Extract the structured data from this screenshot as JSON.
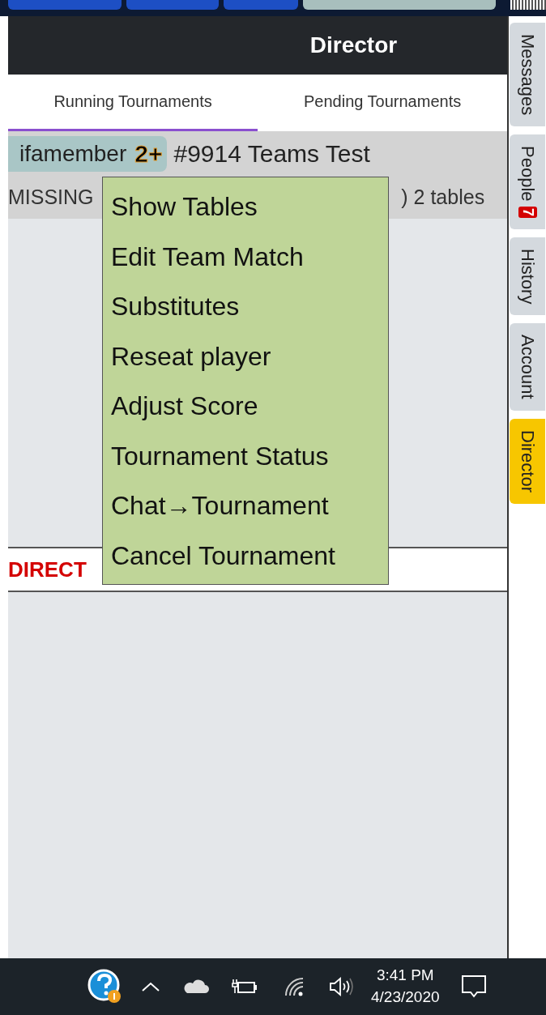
{
  "browser_tabs": [
    {
      "selected": false
    },
    {
      "selected": false
    },
    {
      "selected": false
    },
    {
      "selected": true
    }
  ],
  "header": {
    "title": "Director"
  },
  "tabs": [
    {
      "label": "Running Tournaments",
      "selected": true
    },
    {
      "label": "Pending Tournaments",
      "selected": false
    }
  ],
  "tournament": {
    "user": "ifamember",
    "badge": "2+",
    "title": "#9914 Teams Test",
    "status_left": "MISSING",
    "status_right": ") 2 tables"
  },
  "director_calls": {
    "label": "DIRECT"
  },
  "context_menu": {
    "items": [
      "Show Tables",
      "Edit Team Match",
      "Substitutes",
      "Reseat player",
      "Adjust Score",
      "Tournament Status",
      "Chat→Tournament",
      "Cancel Tournament"
    ]
  },
  "side_tabs": [
    {
      "label": "Messages",
      "selected": false
    },
    {
      "label": "People",
      "badge": "7",
      "selected": false
    },
    {
      "label": "History",
      "selected": false
    },
    {
      "label": "Account",
      "selected": false
    },
    {
      "label": "Director",
      "selected": true
    }
  ],
  "taskbar": {
    "time": "3:41 PM",
    "date": "4/23/2020"
  }
}
